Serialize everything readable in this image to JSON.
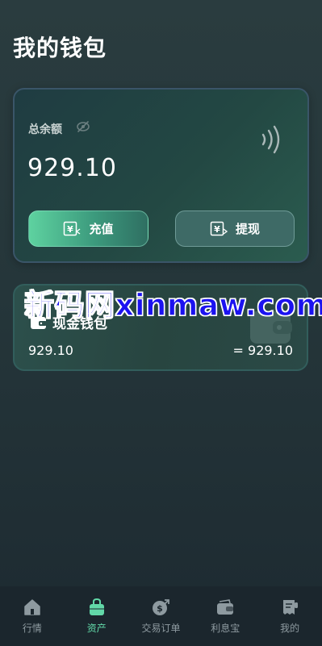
{
  "header": {
    "title": "我的钱包"
  },
  "balance_card": {
    "label": "总余额",
    "amount": "929.10",
    "deposit_label": "充值",
    "withdraw_label": "提现"
  },
  "wallet": {
    "title": "现金钱包",
    "amount": "929.10",
    "converted": "= 929.10"
  },
  "watermark": "新码网xinmaw.com",
  "nav": {
    "items": [
      {
        "label": "行情",
        "icon": "home-icon",
        "active": false
      },
      {
        "label": "资产",
        "icon": "bag-icon",
        "active": true
      },
      {
        "label": "交易订单",
        "icon": "money-bag-icon",
        "active": false
      },
      {
        "label": "利息宝",
        "icon": "wallet-icon",
        "active": false
      },
      {
        "label": "我的",
        "icon": "receipt-icon",
        "active": false
      }
    ]
  },
  "colors": {
    "accent": "#62d8a8",
    "nav_inactive": "#8e9aa0",
    "watermark": "#1b12f0"
  }
}
